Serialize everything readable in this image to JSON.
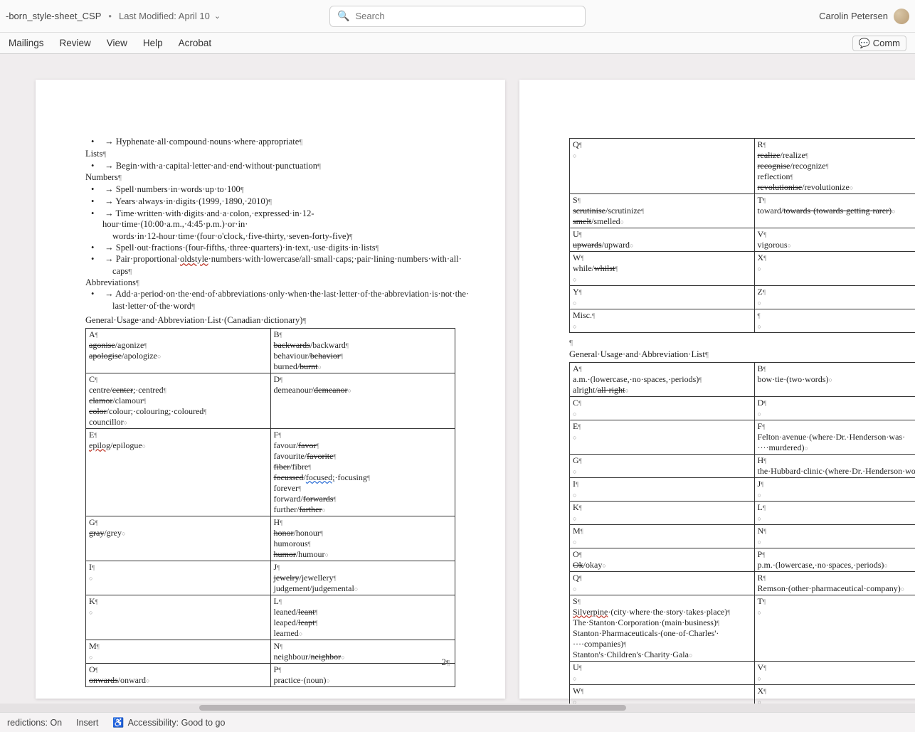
{
  "titlebar": {
    "doc_name": "-born_style-sheet_CSP",
    "last_modified": "Last Modified: April 10",
    "search_placeholder": "Search",
    "user_name": "Carolin Petersen"
  },
  "ribbon": {
    "tabs": [
      "Mailings",
      "Review",
      "View",
      "Help",
      "Acrobat"
    ],
    "comment_label": "Comm"
  },
  "page1": {
    "rules": {
      "hyphenate": "Hyphenate·all·compound·nouns·where·appropriate",
      "lists_heading": "Lists",
      "lists_rule": "Begin·with·a·capital·letter·and·end·without·punctuation",
      "numbers_heading": "Numbers",
      "num1": "Spell·numbers·in·words·up·to·100",
      "num2": "Years·always·in·digits·(1999,·1890,·2010)",
      "num3a": "Time·written·with·digits·and·a·colon,·expressed·in·12-hour·time·(10:00·a.m.,·4:45·p.m.)·or·in·",
      "num3b": "words·in·12-hour·time·(four·o'clock,·five-thirty,·seven-forty-five)",
      "num4": "Spell·out·fractions·(four-fifths,·three·quarters)·in·text,·use·digits·in·lists",
      "num5a": "Pair·proportional·",
      "num5_oldstyle": "oldstyle",
      "num5b": "·numbers·with·lowercase/all·small·caps;·pair·lining·numbers·with·all·",
      "num5c": "caps",
      "abbrev_heading": "Abbreviations",
      "abbrev1a": "Add·a·period·on·the·end·of·abbreviations·only·when·the·last·letter·of·the·abbreviation·is·not·the·",
      "abbrev1b": "last·letter·of·the·word",
      "gu_heading": "General·Usage·and·Abbreviation·List·(Canadian·dictionary)"
    },
    "table": {
      "A": {
        "h": "A",
        "lines": [
          {
            "pre": "agonise",
            "post": "/agonize",
            "strike": true,
            "pil": true
          },
          {
            "pre": "apologise",
            "post": "/apologize",
            "strike": true,
            "end": true
          }
        ]
      },
      "B": {
        "h": "B",
        "lines": [
          {
            "pre": "backwards",
            "post": "/backward",
            "strike": true,
            "pil": true
          },
          {
            "plain": "behaviour/",
            "strk2": "behavior",
            "pil": true
          },
          {
            "plain": "burned/",
            "strk2": "burnt",
            "end": true
          }
        ]
      },
      "C": {
        "h": "C",
        "lines": [
          {
            "plain": "centre/",
            "strk2": "center",
            "post2": ";·centred",
            "pil": true
          },
          {
            "pre": "clamor",
            "post": "/clamour",
            "strike": true,
            "pil": true
          },
          {
            "pre": "color",
            "post": "/colour;·colouring;·coloured",
            "strike": true,
            "pil": true
          },
          {
            "plain": "councillor",
            "end": true
          }
        ]
      },
      "D": {
        "h": "D",
        "lines": [
          {
            "plain": "demeanour/",
            "strk2": "demeanor",
            "end": true
          }
        ]
      },
      "E": {
        "h": "E",
        "lines": [
          {
            "pre_red": "epilog",
            "post": "/epilogue",
            "end": true
          }
        ]
      },
      "F": {
        "h": "F",
        "lines": [
          {
            "plain": "favour/",
            "strk2": "favor",
            "pil": true
          },
          {
            "plain": "favourite/",
            "strk2": "favorite",
            "pil": true
          },
          {
            "pre": "fiber",
            "post": "/fibre",
            "strike": true,
            "pil": true
          },
          {
            "pre": "focussed",
            "post": "/",
            "strike": true,
            "blue": "focused;",
            "post3": "·focusing",
            "pil": true
          },
          {
            "plain": "forever",
            "pil": true
          },
          {
            "plain": "forward/",
            "strk2": "forwards",
            "pil": true
          },
          {
            "plain": "further/",
            "strk2": "farther",
            "end": true
          }
        ]
      },
      "G": {
        "h": "G",
        "lines": [
          {
            "pre": "gray",
            "post": "/grey",
            "strike": true,
            "end": true
          }
        ]
      },
      "H": {
        "h": "H",
        "lines": [
          {
            "pre": "honor",
            "post": "/honour",
            "strike": true,
            "pil": true
          },
          {
            "plain": "humorous",
            "pil": true
          },
          {
            "pre": "humor",
            "post": "/humour",
            "strike": true,
            "end": true
          }
        ]
      },
      "I": {
        "h": "I",
        "lines": [
          {
            "plain": "",
            "end": true
          }
        ]
      },
      "J": {
        "h": "J",
        "lines": [
          {
            "pre": "jewelry",
            "post": "/jewellery",
            "strike": true,
            "pil": true
          },
          {
            "plain": "judgement/judgemental",
            "end": true
          }
        ]
      },
      "K": {
        "h": "K",
        "lines": [
          {
            "plain": "",
            "end": true
          }
        ]
      },
      "L": {
        "h": "L",
        "lines": [
          {
            "plain": "leaned/",
            "strk2": "leant",
            "pil": true
          },
          {
            "plain": "leaped/",
            "strk2": "leapt",
            "pil": true
          },
          {
            "plain": "learned",
            "end": true
          }
        ]
      },
      "M": {
        "h": "M",
        "lines": [
          {
            "plain": "",
            "end": true
          }
        ]
      },
      "N": {
        "h": "N",
        "lines": [
          {
            "plain": "neighbour/",
            "strk2": "neighbor",
            "end": true
          }
        ]
      },
      "O": {
        "h": "O",
        "lines": [
          {
            "pre": "onwards",
            "post": "/onward",
            "strike": true,
            "end": true
          }
        ]
      },
      "P": {
        "h": "P",
        "lines": [
          {
            "plain": "practice·(noun)",
            "end": true
          }
        ]
      }
    },
    "page_number": "2"
  },
  "page2": {
    "table1": {
      "Q": {
        "h": "Q",
        "lines": [
          {
            "plain": "",
            "end": true
          }
        ]
      },
      "R": {
        "h": "R",
        "lines": [
          {
            "pre": "realize",
            "post": "/realize",
            "strike": true,
            "pil": true
          },
          {
            "pre": "recognise",
            "post": "/recognize",
            "strike": true,
            "pil": true
          },
          {
            "plain": "reflection",
            "pil": true
          },
          {
            "pre": "revolutionise",
            "post": "/revolutionize",
            "strike": true,
            "end": true
          }
        ]
      },
      "S": {
        "h": "S",
        "lines": [
          {
            "pre": "scrutinise",
            "post": "/scrutinize",
            "strike": true,
            "pil": true
          },
          {
            "pre": "smelt",
            "post": "/smelled",
            "strike": true,
            "end": true
          }
        ]
      },
      "T": {
        "h": "T",
        "lines": [
          {
            "plain": "toward/",
            "strk2": "towards·(towards·getting·rarer)",
            "end": true
          }
        ]
      },
      "U": {
        "h": "U",
        "lines": [
          {
            "pre": "upwards",
            "post": "/upward",
            "strike": true,
            "end": true
          }
        ]
      },
      "V": {
        "h": "V",
        "lines": [
          {
            "plain": "vigorous",
            "end": true
          }
        ]
      },
      "W": {
        "h": "W",
        "lines": [
          {
            "plain": "while/",
            "strk2": "whilst",
            "pil": true
          },
          {
            "plain": "",
            "end": true
          }
        ]
      },
      "X": {
        "h": "X",
        "lines": [
          {
            "plain": "",
            "end": true
          }
        ]
      },
      "Y": {
        "h": "Y",
        "lines": [
          {
            "plain": "",
            "end": true
          }
        ]
      },
      "Z": {
        "h": "Z",
        "lines": [
          {
            "plain": "",
            "end": true
          }
        ]
      },
      "Misc": {
        "h": "Misc.",
        "lines": [
          {
            "plain": "",
            "end": true
          }
        ]
      },
      "Blank": {
        "h": "",
        "lines": [
          {
            "plain": "",
            "end": true
          }
        ]
      }
    },
    "gu_heading": "General·Usage·and·Abbreviation·List",
    "table2": {
      "A": {
        "h": "A",
        "lines": [
          {
            "plain": "a.m.·(lowercase,·no·spaces,·periods)",
            "pil": true
          },
          {
            "plain": "alright/",
            "strk2": "all·right",
            "end": true
          }
        ]
      },
      "B": {
        "h": "B",
        "lines": [
          {
            "plain": "bow·tie·(two·words)",
            "end": true
          }
        ]
      },
      "C": {
        "h": "C",
        "lines": [
          {
            "plain": "",
            "end": true
          }
        ]
      },
      "D": {
        "h": "D",
        "lines": [
          {
            "plain": "",
            "end": true
          }
        ]
      },
      "E": {
        "h": "E",
        "lines": [
          {
            "plain": "",
            "end": true
          }
        ]
      },
      "F": {
        "h": "F",
        "lines": [
          {
            "plain": "Felton·avenue·(where·Dr.·Henderson·was·",
            "pil": false
          },
          {
            "plain": "····murdered)",
            "end": true
          }
        ]
      },
      "G": {
        "h": "G",
        "lines": [
          {
            "plain": "",
            "end": true
          }
        ]
      },
      "H": {
        "h": "H",
        "lines": [
          {
            "plain": "the·Hubbard·clinic·(where·Dr.·Henderson·worl",
            "end": false
          }
        ]
      },
      "I": {
        "h": "I",
        "lines": [
          {
            "plain": "",
            "end": true
          }
        ]
      },
      "J": {
        "h": "J",
        "lines": [
          {
            "plain": "",
            "end": true
          }
        ]
      },
      "K": {
        "h": "K",
        "lines": [
          {
            "plain": "",
            "end": true
          }
        ]
      },
      "L": {
        "h": "L",
        "lines": [
          {
            "plain": "",
            "end": true
          }
        ]
      },
      "M": {
        "h": "M",
        "lines": [
          {
            "plain": "",
            "end": true
          }
        ]
      },
      "N": {
        "h": "N",
        "lines": [
          {
            "plain": "",
            "end": true
          }
        ]
      },
      "O": {
        "h": "O",
        "lines": [
          {
            "pre": "Ok",
            "post": "/okay",
            "strike": true,
            "end": true
          }
        ]
      },
      "P": {
        "h": "P",
        "lines": [
          {
            "plain": "p.m.·(lowercase,·no·spaces,·periods)",
            "end": true
          }
        ]
      },
      "Q": {
        "h": "Q",
        "lines": [
          {
            "plain": "",
            "end": true
          }
        ]
      },
      "R": {
        "h": "R",
        "lines": [
          {
            "plain": "Remson·(other·pharmaceutical·company)",
            "end": true
          }
        ]
      },
      "S": {
        "h": "S",
        "lines": [
          {
            "red": "Silverpine",
            "post": "·(city·where·the·story·takes·place)",
            "pil": true
          },
          {
            "plain": "The·Stanton·Corporation·(main·business)",
            "pil": true
          },
          {
            "plain": "Stanton·Pharmaceuticals·(one·of·Charles'·",
            "pil": false
          },
          {
            "plain": "····companies)",
            "pil": true
          },
          {
            "plain": "Stanton's·Children's·Charity·Gala",
            "end": true
          }
        ]
      },
      "T": {
        "h": "T",
        "lines": [
          {
            "plain": "",
            "end": true
          }
        ]
      },
      "U": {
        "h": "U",
        "lines": [
          {
            "plain": "",
            "end": true
          }
        ]
      },
      "V": {
        "h": "V",
        "lines": [
          {
            "plain": "",
            "end": true
          }
        ]
      },
      "W": {
        "h": "W",
        "lines": [
          {
            "plain": "",
            "end": true
          }
        ]
      },
      "X": {
        "h": "X",
        "lines": [
          {
            "plain": "",
            "end": true
          }
        ]
      }
    }
  },
  "statusbar": {
    "predictions": "redictions: On",
    "insert": "Insert",
    "accessibility": "Accessibility: Good to go"
  }
}
